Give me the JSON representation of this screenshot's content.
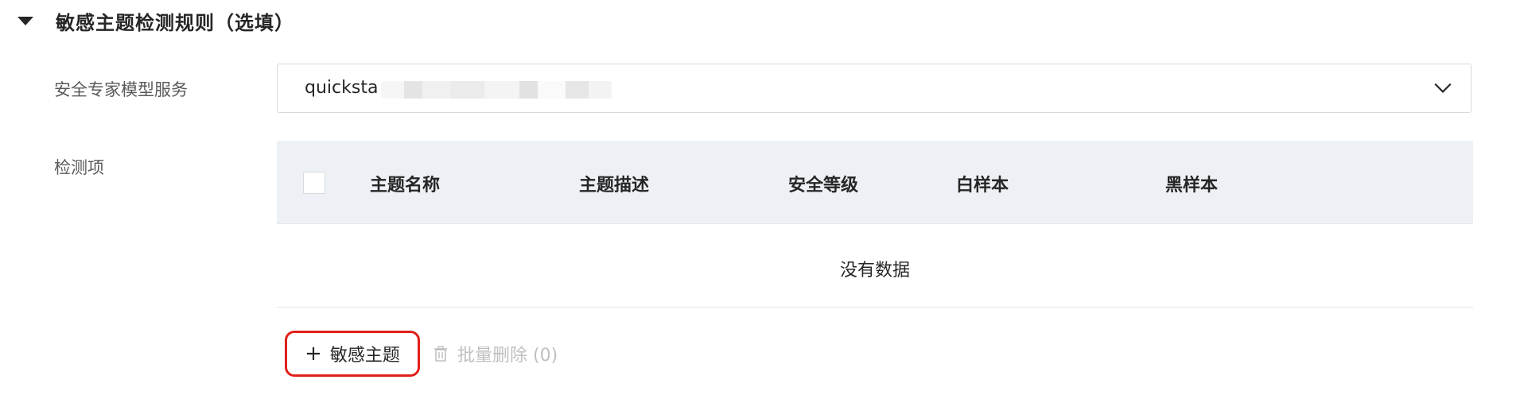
{
  "section": {
    "title": "敏感主题检测规则（选填）"
  },
  "service": {
    "label": "安全专家模型服务",
    "value": "quicksta"
  },
  "items": {
    "label": "检测项"
  },
  "table": {
    "columns": [
      "主题名称",
      "主题描述",
      "安全等级",
      "白样本",
      "黑样本"
    ],
    "empty_text": "没有数据"
  },
  "actions": {
    "add_label": "敏感主题",
    "batch_delete_label": "批量删除 (0)"
  },
  "colors": {
    "highlight": "#e0201b",
    "header_bg": "#edf0f5"
  }
}
